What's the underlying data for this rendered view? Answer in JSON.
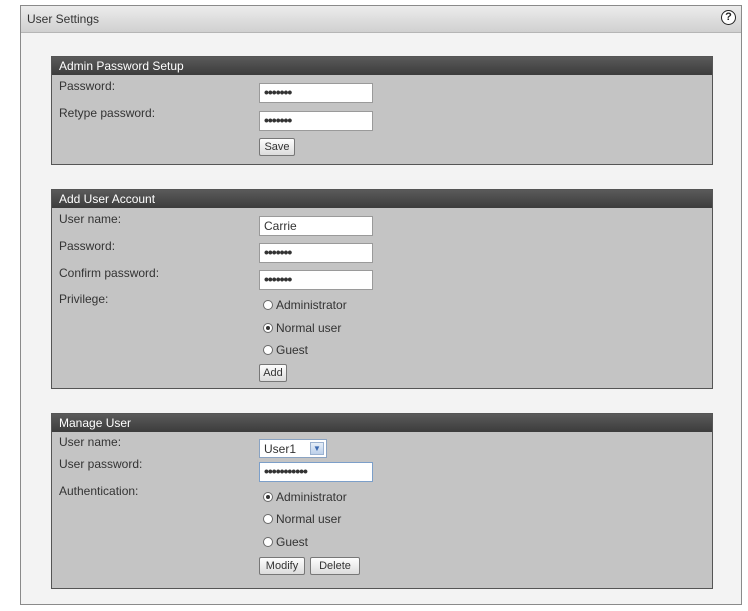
{
  "window": {
    "title": "User Settings",
    "help_icon": "?"
  },
  "admin_password": {
    "header": "Admin Password Setup",
    "password_label": "Password:",
    "password_value": "•••••••",
    "retype_label": "Retype password:",
    "retype_value": "•••••••",
    "save_label": "Save"
  },
  "add_user": {
    "header": "Add User Account",
    "username_label": "User name:",
    "username_value": "Carrie",
    "password_label": "Password:",
    "password_value": "•••••••",
    "confirm_label": "Confirm password:",
    "confirm_value": "•••••••",
    "privilege_label": "Privilege:",
    "options": [
      "Administrator",
      "Normal user",
      "Guest"
    ],
    "selected": "Normal user",
    "add_label": "Add"
  },
  "manage_user": {
    "header": "Manage User",
    "username_label": "User name:",
    "username_value": "User1",
    "password_label": "User password:",
    "password_value": "•••••••••••",
    "auth_label": "Authentication:",
    "options": [
      "Administrator",
      "Normal user",
      "Guest"
    ],
    "selected": "Administrator",
    "modify_label": "Modify",
    "delete_label": "Delete"
  }
}
